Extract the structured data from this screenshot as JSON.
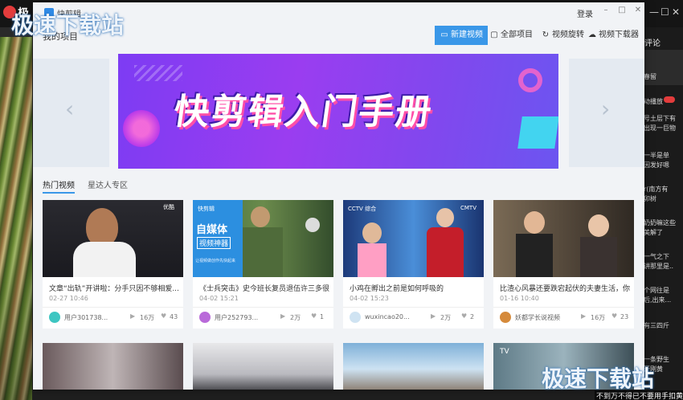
{
  "background_app": {
    "logo_text": "极",
    "window_controls": [
      "—",
      "☐",
      "✕"
    ],
    "right_tab_label": "评论",
    "right_panel_snippets": [
      "春留",
      "动播放",
      "号土层下有",
      "出现一巨物",
      "一半是单",
      "因发好嗯",
      "r(南方有",
      "卯树",
      "奶奶嘛这些",
      "美解了",
      "一气之下",
      "讲那里是..",
      "个网往是",
      "后,出来...",
      "有三四斤",
      "一条野生",
      "开刚黄"
    ],
    "bottom_caption": "不到万不得已不要用手扣黄"
  },
  "dialog": {
    "app_name": "快剪辑",
    "page_title": "我的项目",
    "login_label": "登录",
    "window_controls": [
      "–",
      "□",
      "✕"
    ],
    "toolbar": [
      {
        "label": "新建视频",
        "icon": "video-camera-icon",
        "glyph": "▭",
        "primary": true
      },
      {
        "label": "全部项目",
        "icon": "folder-icon",
        "glyph": "▢",
        "primary": false
      },
      {
        "label": "视频旋转",
        "icon": "rotate-icon",
        "glyph": "↻",
        "primary": false
      },
      {
        "label": "视频下载器",
        "icon": "cloud-download-icon",
        "glyph": "☁",
        "primary": false
      }
    ],
    "banner": {
      "title": "快剪辑入门手册",
      "arrow_left": "‹",
      "arrow_right": "›",
      "accent": "#8a3cf0"
    },
    "tabs": [
      {
        "label": "热门视频",
        "active": true
      },
      {
        "label": "星达人专区",
        "active": false
      }
    ],
    "cards": [
      {
        "title": "文章“出轨”开讲啦：分手只因不够相爱...",
        "date": "02-27 10:46",
        "user": "用户301738...",
        "views": "16万",
        "likes": "43",
        "thumb_label": "优酷"
      },
      {
        "title": "《士兵突击》史今班长复员退伍许三多很...",
        "date": "04-02 15:21",
        "user": "用户252793...",
        "views": "2万",
        "likes": "1",
        "thumb_badge_lines": [
          "快剪辑",
          "自媒体",
          "视频神器",
          "让视频做创作先快起来"
        ]
      },
      {
        "title": "小鸡在孵出之前是如何呼吸的",
        "date": "04-02 15:23",
        "user": "wuxincao20...",
        "views": "2万",
        "likes": "2",
        "thumb_label": "CCTV 综合",
        "thumb_label_right": "CMTV"
      },
      {
        "title": "比渣心风暴还要跌宕起伏的夫妻生活，你...",
        "date": "01-16 10:40",
        "user": "妖都学长说视频",
        "views": "16万",
        "likes": "23"
      }
    ],
    "row2_labels": [
      "",
      "",
      "",
      "TV"
    ]
  },
  "watermark_text": "极速下载站",
  "colors": {
    "primary_button": "#3a97e8",
    "dialog_bg": "#f1f3f6"
  }
}
